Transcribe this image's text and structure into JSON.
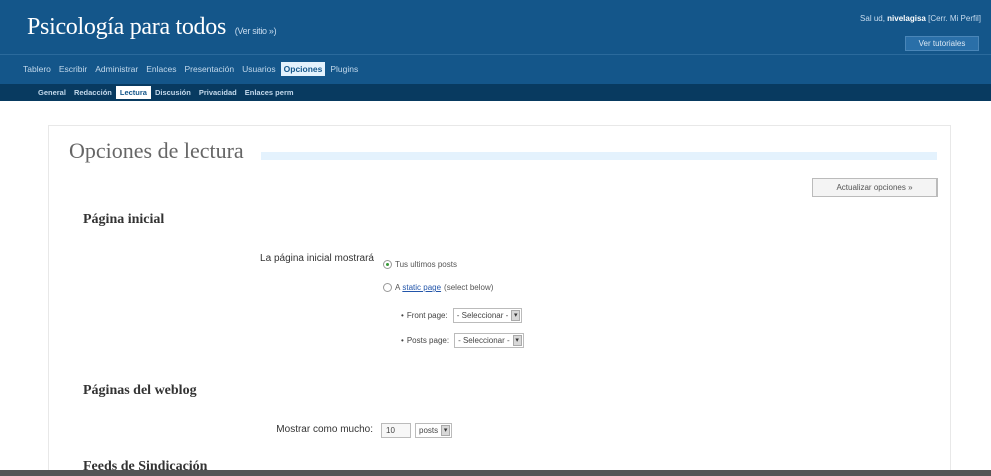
{
  "header": {
    "site_title": "Psicología para todos",
    "view_site": "(Ver sitio »)",
    "user_prefix": "Sal ud,",
    "user_name": "nivelagisa",
    "user_links": "[Cerr. Mi Perfil]",
    "button": "Ver tutoriales"
  },
  "mainmenu": {
    "items": [
      {
        "label": "Tablero"
      },
      {
        "label": "Escribir"
      },
      {
        "label": "Administrar"
      },
      {
        "label": "Enlaces"
      },
      {
        "label": "Presentación"
      },
      {
        "label": "Usuarios"
      },
      {
        "label": "Opciones"
      },
      {
        "label": "Plugins"
      }
    ],
    "current": "Opciones"
  },
  "submenu": {
    "items": [
      {
        "label": "General"
      },
      {
        "label": "Redacción"
      },
      {
        "label": "Lectura"
      },
      {
        "label": "Discusión"
      },
      {
        "label": "Privacidad"
      },
      {
        "label": "Enlaces perm"
      }
    ],
    "current": "Lectura"
  },
  "page": {
    "title": "Opciones de lectura",
    "update_button": "Actualizar opciones »"
  },
  "front_page": {
    "heading": "Página inicial",
    "label": "La página inicial mostrará",
    "option_latest": "Tus ultimos posts",
    "option_static_prefix": "A",
    "option_static_link": "static page",
    "option_static_suffix": "(select below)",
    "option_selected": "latest",
    "front_page_label": "Front page:",
    "front_page_value": "- Seleccionar -",
    "posts_page_label": "Posts page:",
    "posts_page_value": "- Seleccionar -"
  },
  "blog_pages": {
    "heading": "Páginas del weblog",
    "label": "Mostrar como mucho:",
    "count_value": "10",
    "unit_value": "posts"
  },
  "feeds": {
    "heading": "Feeds de Sindicación"
  },
  "icons": {
    "radio": "radio-icon",
    "dropdown": "dropdown-arrow-icon",
    "bullet": "bullet-icon"
  },
  "colors": {
    "header_bg": "#14568a",
    "submenu_bg": "#083a60",
    "current_tab_bg": "#e4f2fd"
  }
}
